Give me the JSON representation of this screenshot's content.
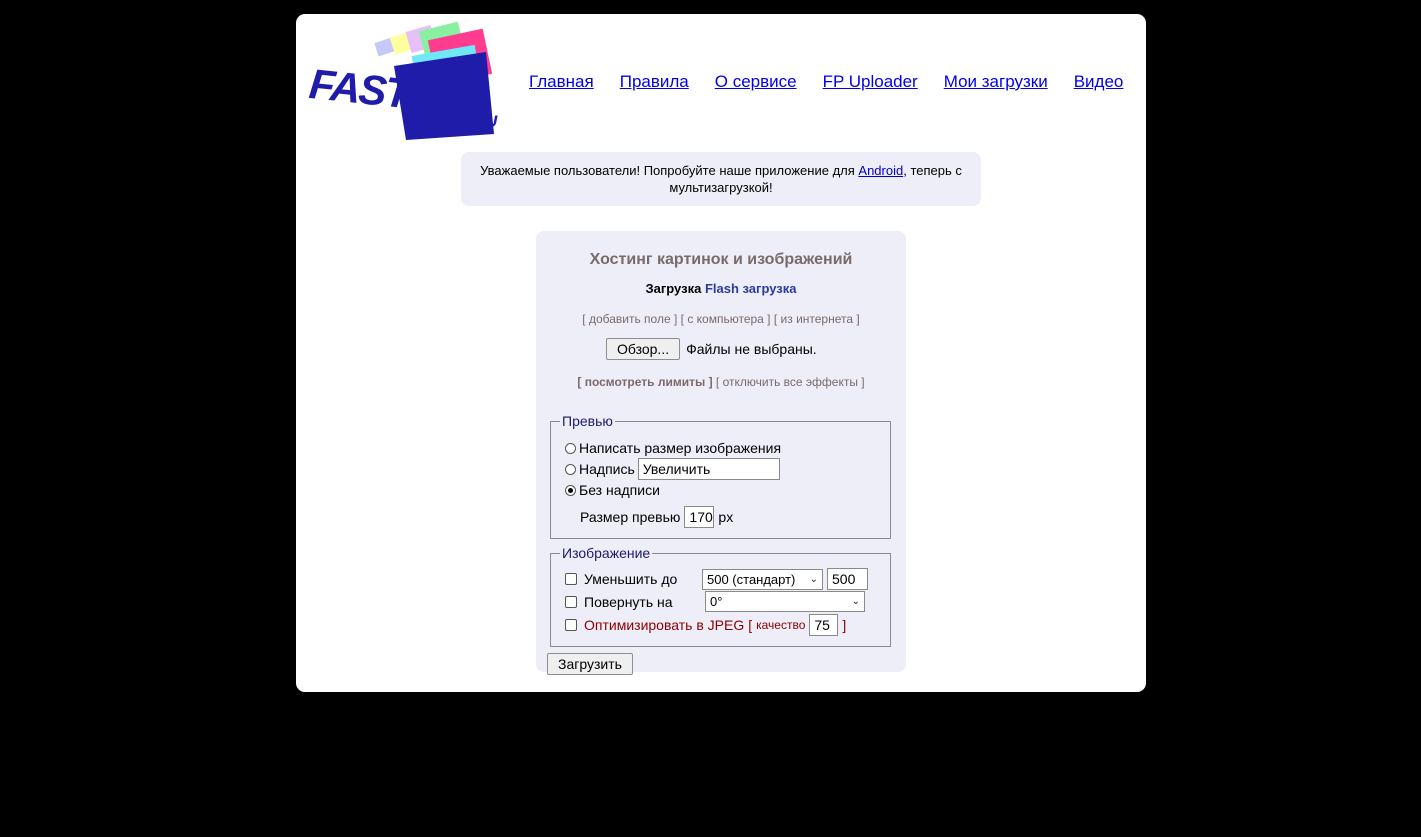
{
  "logo": {
    "text_main": "FASTPIC",
    "text_suffix": ".RU"
  },
  "nav": [
    {
      "label": "Главная"
    },
    {
      "label": "Правила"
    },
    {
      "label": "О сервисе"
    },
    {
      "label": "FP Uploader"
    },
    {
      "label": "Мои загрузки"
    },
    {
      "label": "Видео"
    }
  ],
  "notice": {
    "prefix": "Уважаемые пользователи! Попробуйте наше приложение для ",
    "link": "Android",
    "suffix": ", теперь с мультизагрузкой!"
  },
  "panel": {
    "title": "Хостинг картинок и изображений",
    "mode_active": "Загрузка",
    "mode_flash": "Flash загрузка",
    "source_links": [
      "[ добавить поле ]",
      "[ с компьютера ]",
      "[ из интернета ]"
    ],
    "browse_button": "Обзор...",
    "file_status": "Файлы не выбраны.",
    "limits_link": "[ посмотреть лимиты ]",
    "effects_link": "[ отключить все эффекты ]",
    "preview": {
      "legend": "Превью",
      "option_size": "Написать размер изображения",
      "option_caption": "Надпись",
      "caption_value": "Увеличить",
      "option_none": "Без надписи",
      "size_label": "Размер превью",
      "size_value": "170",
      "size_unit": "px"
    },
    "image": {
      "legend": "Изображение",
      "resize_label": "Уменьшить до",
      "resize_select": "500 (стандарт)",
      "resize_value": "500",
      "rotate_label": "Повернуть на",
      "rotate_select": "0°",
      "jpeg_label": "Оптимизировать в JPEG",
      "jpeg_open": "[",
      "quality_label": "качество",
      "quality_value": "75",
      "jpeg_close": "]"
    },
    "submit_button": "Загрузить"
  },
  "colors": {
    "background": "#000000",
    "page": "#ffffff",
    "panel": "#eeeef8",
    "link": "#0000ee",
    "title": "#7a6a6a",
    "jpeg_label": "#8b0000"
  }
}
